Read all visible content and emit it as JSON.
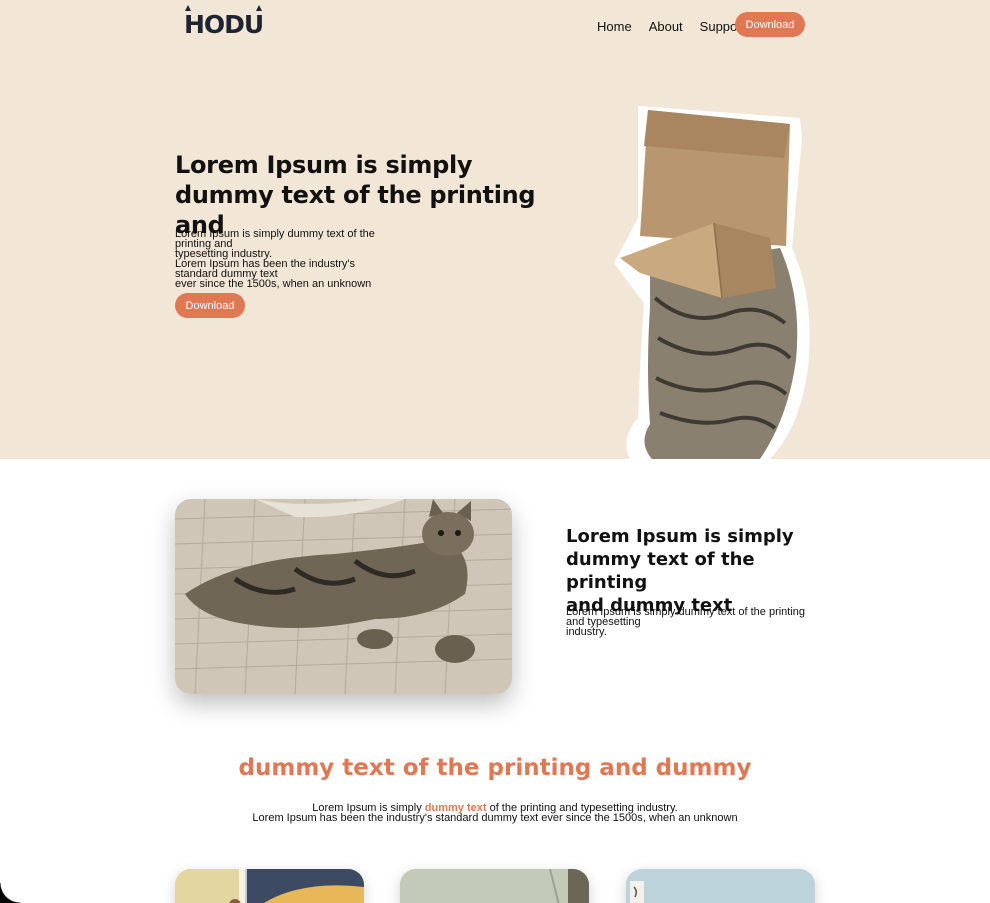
{
  "brand": {
    "logo_text": "HODU",
    "accent_color": "#df7853",
    "hero_bg": "#f2e6d6",
    "text_color": "#1f2433"
  },
  "nav": {
    "items": [
      "Home",
      "About",
      "Support"
    ],
    "download_label": "Download"
  },
  "hero": {
    "title_line1": "Lorem Ipsum is simply",
    "title_line2": "dummy text of the printing and",
    "desc_line1": "Lorem Ipsum is simply dummy text of the printing and",
    "desc_line2": "typesetting industry.",
    "desc_line3": "Lorem Ipsum has been the industry's standard dummy text",
    "desc_line4": "ever since the 1500s, when an unknown",
    "button_label": "Download",
    "image": "cat-with-cardboard-box-on-head"
  },
  "feature": {
    "image": "tabby-cat-lying-on-bed",
    "title_line1": "Lorem Ipsum is simply",
    "title_line2": "dummy text of the printing",
    "title_line3": "and dummy text",
    "desc_line1": "Lorem Ipsum is simply dummy text of the printing and typesetting",
    "desc_line2": "industry."
  },
  "section": {
    "title": "dummy text of the printing and dummy",
    "desc_pre": "Lorem Ipsum is simply ",
    "desc_accent": "dummy text",
    "desc_post": " of the printing and typesetting industry.",
    "desc_line2": "Lorem Ipsum has been the industry's standard dummy text ever since the 1500s, when an unknown"
  },
  "cards": [
    {
      "image": "card-photo-1"
    },
    {
      "image": "card-photo-2"
    },
    {
      "image": "card-photo-3"
    }
  ]
}
